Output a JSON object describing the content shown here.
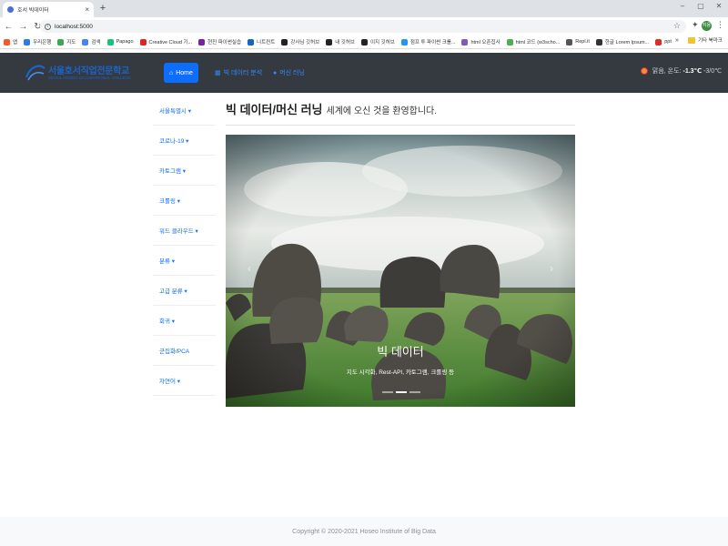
{
  "browser": {
    "tab_title": "호서 빅데이터",
    "new_tab": "+",
    "url": "localhost:5000",
    "window_controls": [
      "–",
      "▢",
      "✕"
    ],
    "profile_initials": "지용",
    "bookmarks": [
      {
        "label": "앱",
        "color": "#f25a2b"
      },
      {
        "label": "우리은행",
        "color": "#2a7de1"
      },
      {
        "label": "지도",
        "color": "#34a853"
      },
      {
        "label": "검색",
        "color": "#4285f4"
      },
      {
        "label": "Papago",
        "color": "#19c37d"
      },
      {
        "label": "Creative Cloud 기...",
        "color": "#e32222"
      },
      {
        "label": "현진 파이썬실습",
        "color": "#7b1fa2"
      },
      {
        "label": "니트컨트",
        "color": "#1565c0"
      },
      {
        "label": "강사님 깃허브",
        "color": "#222222"
      },
      {
        "label": "내 깃허브",
        "color": "#222222"
      },
      {
        "label": "이지 깃허브",
        "color": "#222222"
      },
      {
        "label": "점프 투 파이썬 크롤...",
        "color": "#2196f3"
      },
      {
        "label": "html 오픈집사",
        "color": "#7e57c2"
      },
      {
        "label": "html 코드 (w3scho...",
        "color": "#4caf50"
      },
      {
        "label": "Repl.it",
        "color": "#555555"
      },
      {
        "label": "한글 Lorem Ipsum...",
        "color": "#333333"
      },
      {
        "label": "ppt",
        "color": "#d93025"
      }
    ],
    "bookmarks_more": "»",
    "other_bookmarks": "기타 북마크"
  },
  "site": {
    "logo_line1": "서울호서직업전문학교",
    "logo_line2": "SEOUL HOSEO OCCUPATIONAL COLLEGE",
    "nav": [
      {
        "label": "Home",
        "icon": "home-icon",
        "glyph": "⌂"
      },
      {
        "label": "빅 데이터 분석",
        "icon": "chart-icon",
        "glyph": "▦"
      },
      {
        "label": "머신 러닝",
        "icon": "circle-icon",
        "glyph": "●"
      }
    ],
    "weather_text": "맑음, 온도:",
    "weather_temp": "-1.3℃",
    "weather_range": "-3/0℃"
  },
  "sidebar": {
    "items": [
      {
        "label": "서울특별시 ▾"
      },
      {
        "label": "코로나-19 ▾"
      },
      {
        "label": "카토그램 ▾"
      },
      {
        "label": "크롤링 ▾"
      },
      {
        "label": "워드 클라우드 ▾"
      },
      {
        "label": "분류 ▾"
      },
      {
        "label": "고급 분류 ▾"
      },
      {
        "label": "회귀 ▾"
      },
      {
        "label": "군집화/PCA"
      },
      {
        "label": "자연어 ▾"
      }
    ]
  },
  "main": {
    "title_bold": "빅 데이터/머신 러닝",
    "title_rest": "세계에 오신 것을 환영합니다.",
    "carousel": {
      "prev": "‹",
      "next": "›",
      "caption_title": "빅 데이터",
      "caption_text": "지도 시각화, Rest-API, 카토그램, 크롤링 등",
      "slides": 3,
      "active_slide": 2
    }
  },
  "footer": {
    "text": "Copyright © 2020-2021 Hoseo Institute of Big Data"
  }
}
